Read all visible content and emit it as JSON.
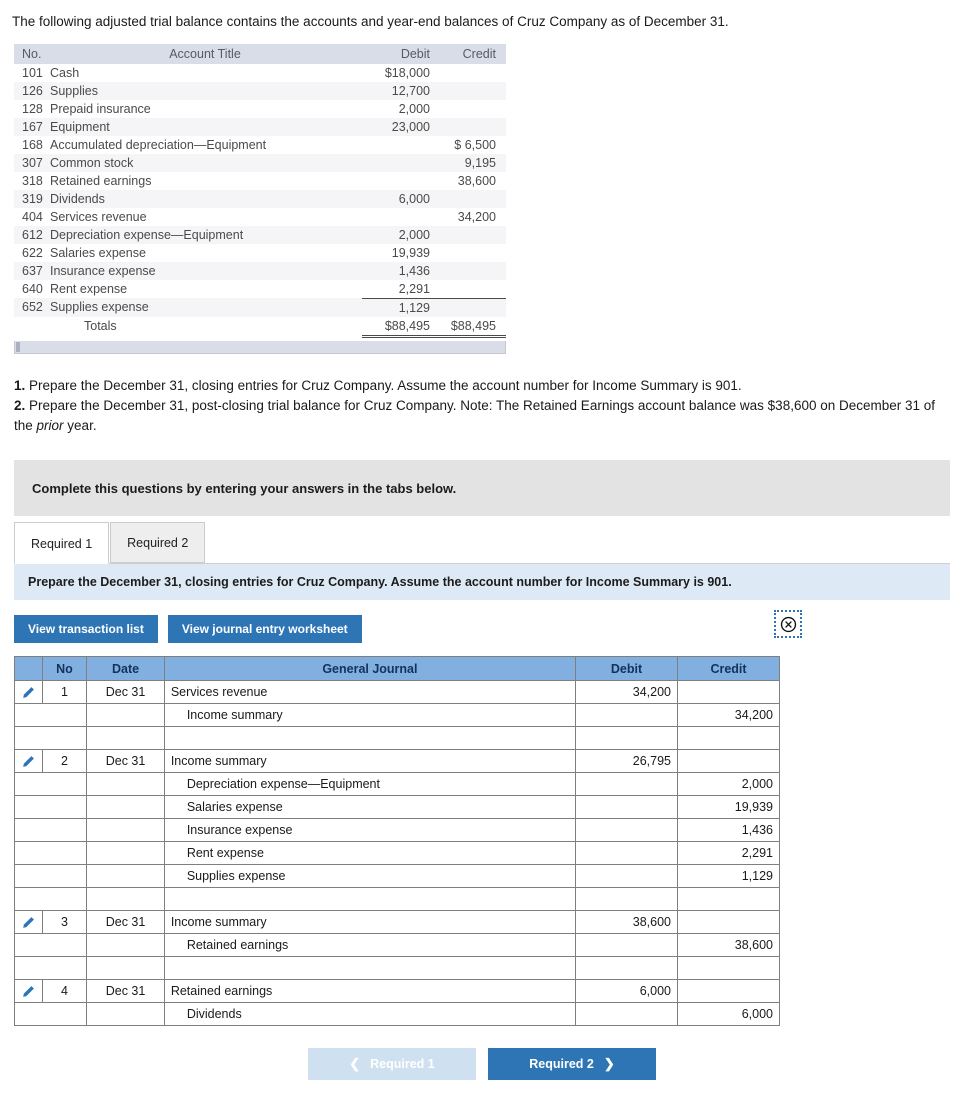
{
  "intro": "The following adjusted trial balance contains the accounts and year-end balances of Cruz Company as of December 31.",
  "trial_balance": {
    "headers": {
      "no": "No.",
      "title": "Account Title",
      "debit": "Debit",
      "credit": "Credit"
    },
    "rows": [
      {
        "no": "101",
        "title": "Cash",
        "debit": "$18,000",
        "credit": ""
      },
      {
        "no": "126",
        "title": "Supplies",
        "debit": "12,700",
        "credit": ""
      },
      {
        "no": "128",
        "title": "Prepaid insurance",
        "debit": "2,000",
        "credit": ""
      },
      {
        "no": "167",
        "title": "Equipment",
        "debit": "23,000",
        "credit": ""
      },
      {
        "no": "168",
        "title": "Accumulated depreciation—Equipment",
        "debit": "",
        "credit": "$ 6,500"
      },
      {
        "no": "307",
        "title": "Common stock",
        "debit": "",
        "credit": "9,195"
      },
      {
        "no": "318",
        "title": "Retained earnings",
        "debit": "",
        "credit": "38,600"
      },
      {
        "no": "319",
        "title": "Dividends",
        "debit": "6,000",
        "credit": ""
      },
      {
        "no": "404",
        "title": "Services revenue",
        "debit": "",
        "credit": "34,200"
      },
      {
        "no": "612",
        "title": "Depreciation expense—Equipment",
        "debit": "2,000",
        "credit": ""
      },
      {
        "no": "622",
        "title": "Salaries expense",
        "debit": "19,939",
        "credit": ""
      },
      {
        "no": "637",
        "title": "Insurance expense",
        "debit": "1,436",
        "credit": ""
      },
      {
        "no": "640",
        "title": "Rent expense",
        "debit": "2,291",
        "credit": ""
      },
      {
        "no": "652",
        "title": "Supplies expense",
        "debit": "1,129",
        "credit": ""
      }
    ],
    "totals": {
      "label": "Totals",
      "debit": "$88,495",
      "credit": "$88,495"
    }
  },
  "requirements": {
    "num1": "1.",
    "text1": "Prepare the December 31, closing entries for Cruz Company. Assume the account number for Income Summary is 901.",
    "num2": "2.",
    "text2a": "Prepare the December 31, post-closing trial balance for Cruz Company. Note: The Retained Earnings account balance was $38,600 on December 31 of the ",
    "text2i": "prior",
    "text2b": " year."
  },
  "instruction_bar": "Complete this questions by entering your answers in the tabs below.",
  "tabs": [
    {
      "label": "Required 1",
      "active": true
    },
    {
      "label": "Required 2",
      "active": false
    }
  ],
  "banner": "Prepare the December 31, closing entries for Cruz Company. Assume the account number for Income Summary is 901.",
  "action_buttons": {
    "transaction_list": "View transaction list",
    "journal_worksheet": "View journal entry worksheet",
    "close_icon": "close-circle-icon"
  },
  "journal": {
    "headers": {
      "no": "No",
      "date": "Date",
      "general_journal": "General Journal",
      "debit": "Debit",
      "credit": "Credit"
    },
    "rows": [
      {
        "edit": true,
        "no": "1",
        "date": "Dec 31",
        "account": "Services revenue",
        "indent": false,
        "debit": "34,200",
        "credit": ""
      },
      {
        "edit": false,
        "no": "",
        "date": "",
        "account": "Income summary",
        "indent": true,
        "debit": "",
        "credit": "34,200"
      },
      {
        "edit": false,
        "no": "",
        "date": "",
        "account": "",
        "indent": false,
        "debit": "",
        "credit": ""
      },
      {
        "edit": true,
        "no": "2",
        "date": "Dec 31",
        "account": "Income summary",
        "indent": false,
        "debit": "26,795",
        "credit": ""
      },
      {
        "edit": false,
        "no": "",
        "date": "",
        "account": "Depreciation expense—Equipment",
        "indent": true,
        "debit": "",
        "credit": "2,000"
      },
      {
        "edit": false,
        "no": "",
        "date": "",
        "account": "Salaries expense",
        "indent": true,
        "debit": "",
        "credit": "19,939"
      },
      {
        "edit": false,
        "no": "",
        "date": "",
        "account": "Insurance expense",
        "indent": true,
        "debit": "",
        "credit": "1,436"
      },
      {
        "edit": false,
        "no": "",
        "date": "",
        "account": "Rent expense",
        "indent": true,
        "debit": "",
        "credit": "2,291"
      },
      {
        "edit": false,
        "no": "",
        "date": "",
        "account": "Supplies expense",
        "indent": true,
        "debit": "",
        "credit": "1,129"
      },
      {
        "edit": false,
        "no": "",
        "date": "",
        "account": "",
        "indent": false,
        "debit": "",
        "credit": ""
      },
      {
        "edit": true,
        "no": "3",
        "date": "Dec 31",
        "account": "Income summary",
        "indent": false,
        "debit": "38,600",
        "credit": ""
      },
      {
        "edit": false,
        "no": "",
        "date": "",
        "account": "Retained earnings",
        "indent": true,
        "debit": "",
        "credit": "38,600"
      },
      {
        "edit": false,
        "no": "",
        "date": "",
        "account": "",
        "indent": false,
        "debit": "",
        "credit": ""
      },
      {
        "edit": true,
        "no": "4",
        "date": "Dec 31",
        "account": "Retained earnings",
        "indent": false,
        "debit": "6,000",
        "credit": ""
      },
      {
        "edit": false,
        "no": "",
        "date": "",
        "account": "Dividends",
        "indent": true,
        "debit": "",
        "credit": "6,000"
      }
    ]
  },
  "footer_nav": {
    "prev_label": "Required 1",
    "next_label": "Required 2",
    "prev_chevron": "chevron-left-icon",
    "next_chevron": "chevron-right-icon"
  },
  "colors": {
    "primary_blue": "#2e75b6",
    "table_header_blue": "#81b0e0",
    "banner_blue": "#ddeaf6",
    "tb_header": "#d9dde8",
    "grey_bar": "#e3e3e3"
  }
}
